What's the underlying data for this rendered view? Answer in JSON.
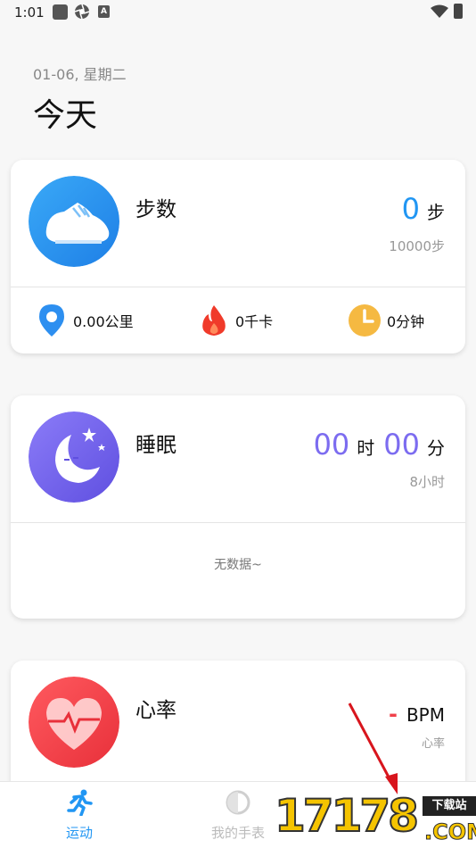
{
  "status_bar": {
    "time": "1:01",
    "icons": [
      "square-icon",
      "aperture-icon",
      "a-icon",
      "wifi-icon",
      "battery-icon"
    ]
  },
  "header": {
    "date": "01-06, 星期二",
    "title": "今天"
  },
  "steps_card": {
    "title": "步数",
    "value": "0",
    "unit": "步",
    "goal": "10000步",
    "stats": [
      {
        "icon": "location-pin-icon",
        "text": "0.00公里"
      },
      {
        "icon": "flame-icon",
        "text": "0千卡"
      },
      {
        "icon": "clock-icon",
        "text": "0分钟"
      }
    ],
    "accent": "#2196f3"
  },
  "sleep_card": {
    "title": "睡眠",
    "hours": "00",
    "hours_unit": "时",
    "minutes": "00",
    "minutes_unit": "分",
    "goal": "8小时",
    "empty_text": "无数据~",
    "accent": "#7c6cf0"
  },
  "heart_card": {
    "title": "心率",
    "value": "-",
    "unit": "BPM",
    "sub": "心率",
    "accent": "#f0414b"
  },
  "bottom_nav": {
    "items": [
      {
        "label": "运动",
        "icon": "running-icon",
        "active": true
      },
      {
        "label": "我的手表",
        "icon": "watch-icon",
        "active": false
      }
    ],
    "active_color": "#2196f3",
    "inactive_color": "#bbbbbb"
  },
  "watermark": {
    "number": "17178",
    "badge": "下载站",
    "suffix": ".COM"
  }
}
